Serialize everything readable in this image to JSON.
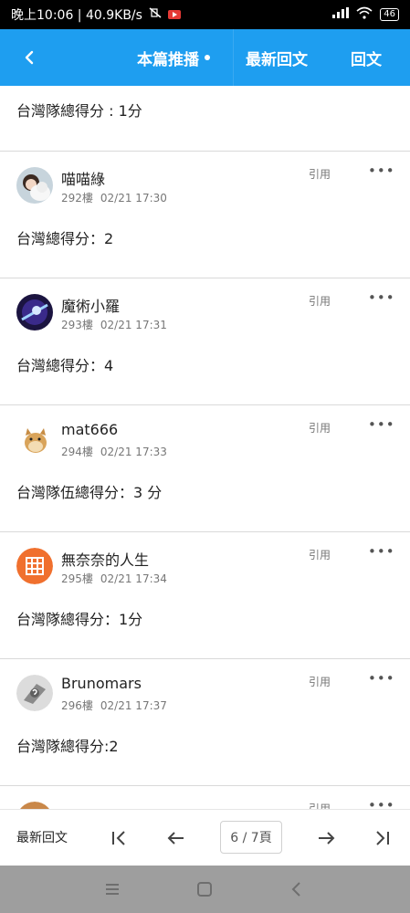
{
  "status_bar": {
    "time_speed": "晚上10:06 | 40.9KB/s",
    "battery": "46",
    "icons": [
      "mute-vibrate-icon",
      "youtube-icon",
      "signal-icon",
      "wifi-icon",
      "battery-icon"
    ]
  },
  "header": {
    "back_icon": "back-arrow-icon",
    "tabs": [
      {
        "label": "本篇推播",
        "has_dot": true
      },
      {
        "label": "最新回文"
      },
      {
        "label": "回文"
      }
    ],
    "color": "#1e9ef0"
  },
  "feed": {
    "first_content": "台灣隊總得分 : 1分",
    "posts": [
      {
        "author": "喵喵綠",
        "floor": "292樓",
        "time": "02/21 17:30",
        "quote": "引用",
        "more": "•••",
        "content": "台灣總得分：2",
        "avatar": "cat-avatar"
      },
      {
        "author": "魔術小羅",
        "floor": "293樓",
        "time": "02/21 17:31",
        "quote": "引用",
        "more": "•••",
        "content": "台灣總得分：4",
        "avatar": "galaxy-avatar"
      },
      {
        "author": "mat666",
        "floor": "294樓",
        "time": "02/21 17:33",
        "quote": "引用",
        "more": "•••",
        "content": "台灣隊伍總得分：3 分",
        "avatar": "doge-avatar"
      },
      {
        "author": "無奈奈的人生",
        "floor": "295樓",
        "time": "02/21 17:34",
        "quote": "引用",
        "more": "•••",
        "content": "台灣隊總得分：1分",
        "avatar": "orange-grid-avatar"
      },
      {
        "author": "Brunomars",
        "floor": "296樓",
        "time": "02/21 17:37",
        "quote": "引用",
        "more": "•••",
        "content": "台灣隊總得分:2",
        "avatar": "gray-default-avatar"
      }
    ],
    "partial": {
      "quote": "引用",
      "more": "•••"
    }
  },
  "pager": {
    "latest_label": "最新回文",
    "page_label": "6 / 7頁",
    "icons": [
      "first-page-icon",
      "prev-page-icon",
      "next-page-icon",
      "last-page-icon"
    ]
  },
  "system_nav": {
    "icons": [
      "menu-icon",
      "home-icon",
      "back-icon"
    ]
  }
}
